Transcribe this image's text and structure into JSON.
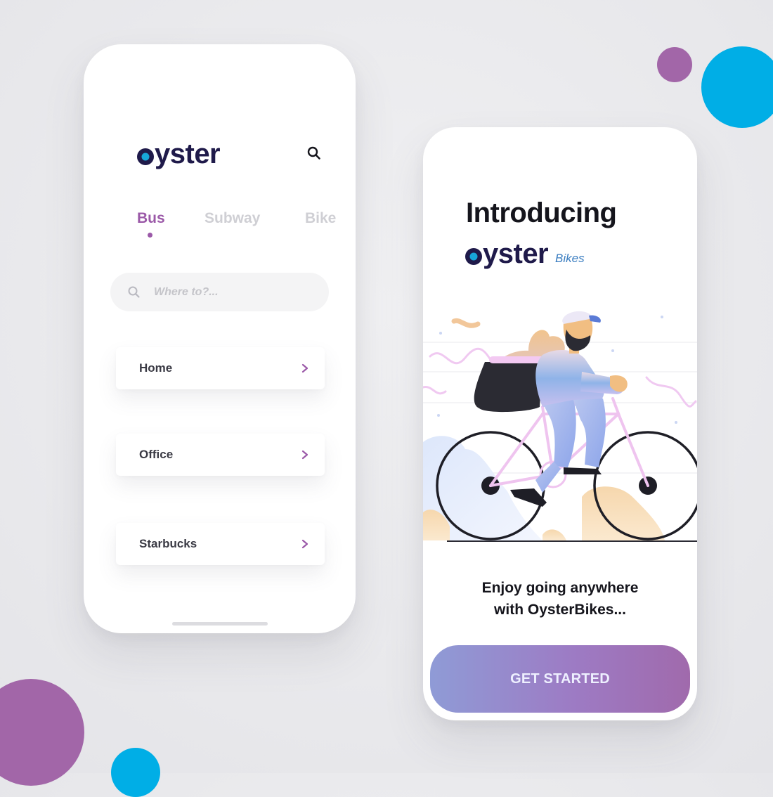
{
  "colors": {
    "brand_navy": "#1f1a4a",
    "accent_purple": "#9b59a8",
    "accent_cyan": "#17a6d9",
    "blob_purple": "#a266a8",
    "blob_cyan": "#00aee6"
  },
  "left_screen": {
    "logo_text": "yster",
    "tabs": [
      {
        "label": "Bus",
        "active": true
      },
      {
        "label": "Subway",
        "active": false
      },
      {
        "label": "Bike",
        "active": false
      }
    ],
    "search": {
      "placeholder": "Where to?...",
      "icon": "search-icon"
    },
    "places": [
      {
        "label": "Home",
        "icon": "chevron-right-icon"
      },
      {
        "label": "Office",
        "icon": "chevron-right-icon"
      },
      {
        "label": "Starbucks",
        "icon": "chevron-right-icon"
      }
    ]
  },
  "right_screen": {
    "title": "Introducing",
    "logo_text": "yster",
    "logo_suffix": "Bikes",
    "tagline_line1": "Enjoy going anywhere",
    "tagline_line2": "with OysterBikes...",
    "cta_label": "GET STARTED",
    "illustration": "cyclist-with-delivery-backpack"
  }
}
